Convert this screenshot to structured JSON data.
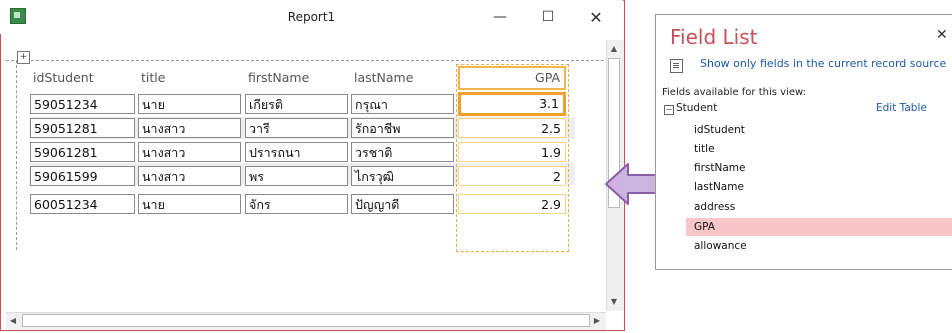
{
  "window": {
    "title": "Report1",
    "minimize": "—",
    "maximize": "☐",
    "close": "✕"
  },
  "report": {
    "columns": [
      "idStudent",
      "title",
      "firstName",
      "lastName",
      "GPA"
    ],
    "rows": [
      [
        "59051234",
        "นาย",
        "เกียรติ",
        "กรุณา",
        "3.1"
      ],
      [
        "59051281",
        "นางสาว",
        "วารี",
        "รักอาชีพ",
        "2.5"
      ],
      [
        "59061281",
        "นางสาว",
        "ปรารถนา",
        "วรชาติ",
        "1.9"
      ],
      [
        "59061599",
        "นางสาว",
        "พร",
        "ไกรวุฒิ",
        "2"
      ],
      [
        "60051234",
        "นาย",
        "จักร",
        "ปัญญาดี",
        "2.9"
      ]
    ]
  },
  "field_list": {
    "title": "Field List",
    "close": "✕",
    "show_only": "Show only fields in the current record source",
    "available_label": "Fields available for this view:",
    "table_name": "Student",
    "edit_table": "Edit Table",
    "expand_glyph": "−",
    "fields": [
      "idStudent",
      "title",
      "firstName",
      "lastName",
      "address",
      "GPA",
      "allowance"
    ],
    "highlighted_field": "GPA"
  },
  "colors": {
    "accent_red": "#c8505a",
    "gpa_orange": "#f0a030",
    "highlight_pink": "#f9c6ca",
    "arrow_purple": "#cdb4e0"
  }
}
